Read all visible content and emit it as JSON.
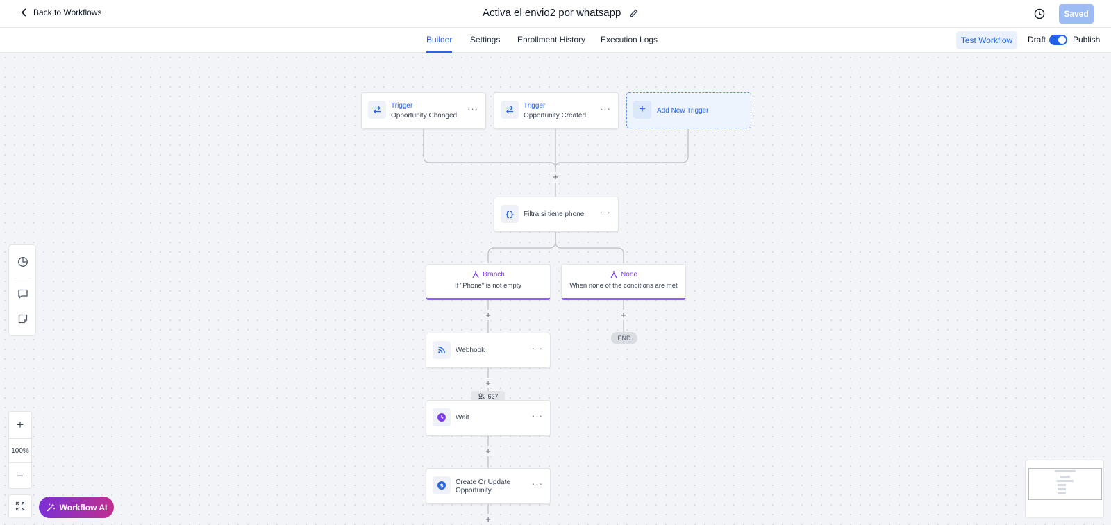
{
  "header": {
    "back_label": "Back to Workflows",
    "title": "Activa el envio2 por whatsapp",
    "saved_label": "Saved"
  },
  "tabs": [
    {
      "label": "Builder",
      "active": true
    },
    {
      "label": "Settings",
      "active": false
    },
    {
      "label": "Enrollment History",
      "active": false
    },
    {
      "label": "Execution Logs",
      "active": false
    }
  ],
  "actions": {
    "test_label": "Test Workflow",
    "draft_label": "Draft",
    "publish_label": "Publish",
    "publish_on": true
  },
  "triggers": [
    {
      "kind": "Trigger",
      "name": "Opportunity Changed"
    },
    {
      "kind": "Trigger",
      "name": "Opportunity Created"
    }
  ],
  "add_trigger_label": "Add New Trigger",
  "filter_node": {
    "label": "Filtra si tiene phone"
  },
  "branches": [
    {
      "title": "Branch",
      "condition": "If \"Phone\" is not empty"
    },
    {
      "title": "None",
      "condition": "When none of the conditions are met"
    }
  ],
  "end_label": "END",
  "actions_nodes": [
    {
      "label": "Webhook",
      "icon": "rss-icon"
    },
    {
      "label": "Wait",
      "icon": "clock-icon"
    },
    {
      "label": "Create Or Update Opportunity",
      "icon": "dollar-icon"
    }
  ],
  "contacts_count": "627",
  "zoom": {
    "level": "100%"
  },
  "ai_label": "Workflow AI",
  "colors": {
    "primary": "#2563eb",
    "branch_accent": "#8b5cf6",
    "saved_button": "#9dbcf3"
  }
}
